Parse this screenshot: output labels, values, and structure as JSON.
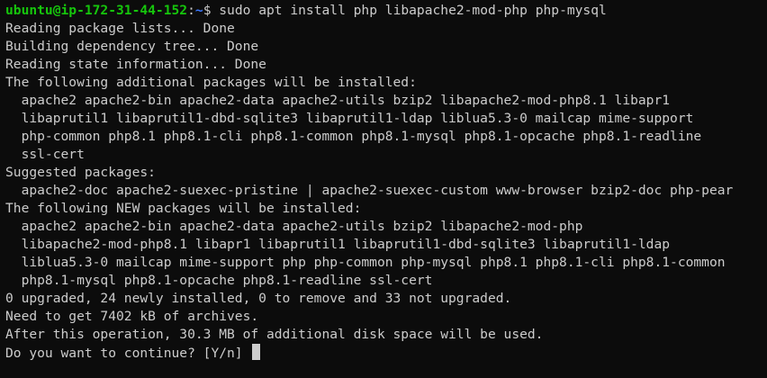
{
  "prompt": {
    "user_host": "ubuntu@ip-172-31-44-152",
    "separator": ":",
    "path": "~",
    "symbol": "$",
    "command": " sudo apt install php libapache2-mod-php php-mysql"
  },
  "output_lines": [
    "Reading package lists... Done",
    "Building dependency tree... Done",
    "Reading state information... Done",
    "The following additional packages will be installed:",
    "  apache2 apache2-bin apache2-data apache2-utils bzip2 libapache2-mod-php8.1 libapr1",
    "  libaprutil1 libaprutil1-dbd-sqlite3 libaprutil1-ldap liblua5.3-0 mailcap mime-support",
    "  php-common php8.1 php8.1-cli php8.1-common php8.1-mysql php8.1-opcache php8.1-readline",
    "  ssl-cert",
    "Suggested packages:",
    "  apache2-doc apache2-suexec-pristine | apache2-suexec-custom www-browser bzip2-doc php-pear",
    "The following NEW packages will be installed:",
    "  apache2 apache2-bin apache2-data apache2-utils bzip2 libapache2-mod-php",
    "  libapache2-mod-php8.1 libapr1 libaprutil1 libaprutil1-dbd-sqlite3 libaprutil1-ldap",
    "  liblua5.3-0 mailcap mime-support php php-common php-mysql php8.1 php8.1-cli php8.1-common",
    "  php8.1-mysql php8.1-opcache php8.1-readline ssl-cert",
    "0 upgraded, 24 newly installed, 0 to remove and 33 not upgraded.",
    "Need to get 7402 kB of archives.",
    "After this operation, 30.3 MB of additional disk space will be used."
  ],
  "continue_prompt": "Do you want to continue? [Y/n] ",
  "colors": {
    "background": "#0c0c0c",
    "text": "#cccccc",
    "user_host": "#16c60c",
    "path": "#3b78ff"
  }
}
